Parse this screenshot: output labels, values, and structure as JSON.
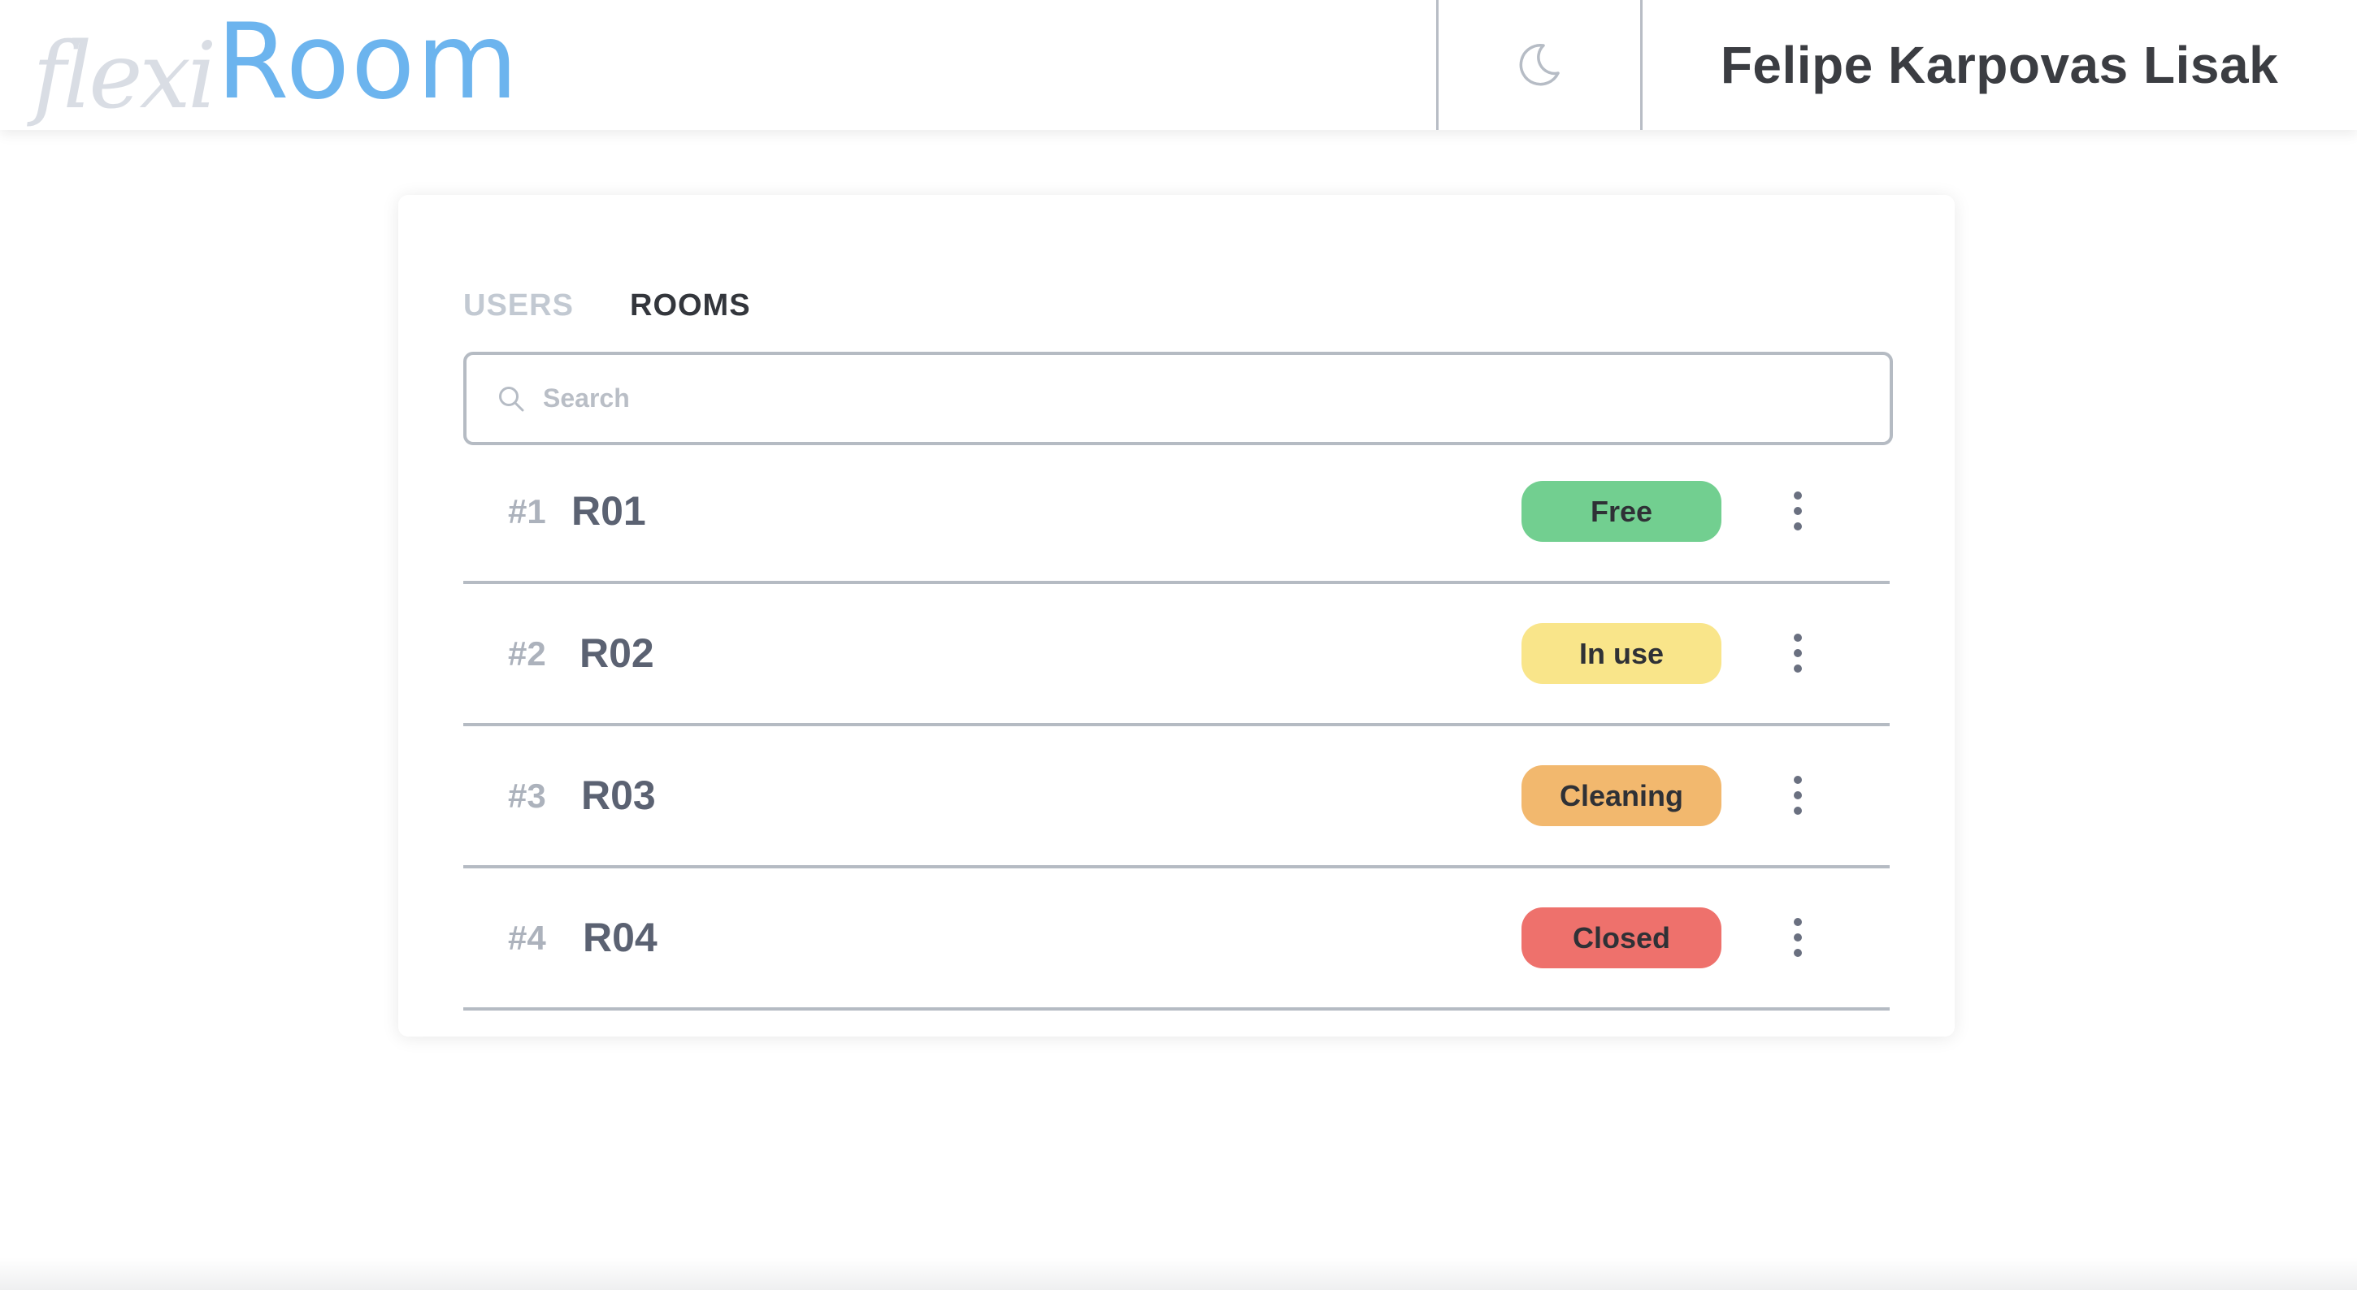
{
  "header": {
    "logo_prefix": "flexi",
    "logo_main": "Room",
    "theme_toggle_icon": "moon-icon",
    "user_name": "Felipe Karpovas Lisak"
  },
  "tabs": [
    {
      "label": "USERS",
      "active": false
    },
    {
      "label": "ROOMS",
      "active": true
    }
  ],
  "search": {
    "placeholder": "Search",
    "value": "",
    "icon": "search-icon"
  },
  "rooms": [
    {
      "number": "#1",
      "name": "R01",
      "status": "Free",
      "status_color": "#72cf90"
    },
    {
      "number": "#2",
      "name": "R02",
      "status": "In use",
      "status_color": "#f9e58a"
    },
    {
      "number": "#3",
      "name": "R03",
      "status": "Cleaning",
      "status_color": "#f2b86e"
    },
    {
      "number": "#4",
      "name": "R04",
      "status": "Closed",
      "status_color": "#ee716c"
    }
  ],
  "colors": {
    "brand": "#6cb4ee",
    "logo_prefix": "#d9dde4",
    "active_tab_underline": "#8ecaf4"
  }
}
